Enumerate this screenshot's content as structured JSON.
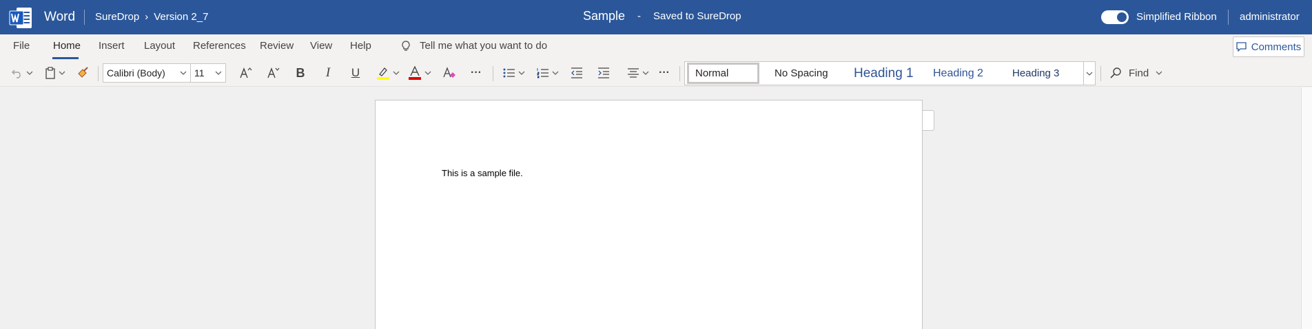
{
  "titlebar": {
    "app_name": "Word",
    "breadcrumb": [
      "SureDrop",
      "Version 2_7"
    ],
    "breadcrumb_sep": "›",
    "doc_name": "Sample",
    "title_sep": "-",
    "save_status": "Saved to SureDrop",
    "simplified_ribbon_label": "Simplified Ribbon",
    "simplified_ribbon_on": true,
    "user": "administrator",
    "colors": {
      "bar": "#2b579a"
    }
  },
  "tabs": {
    "items": [
      "File",
      "Home",
      "Insert",
      "Layout",
      "References",
      "Review",
      "View",
      "Help"
    ],
    "active": "Home",
    "tell_me": "Tell me what you want to do",
    "comments_label": "Comments"
  },
  "ribbon": {
    "font_name": "Calibri (Body)",
    "font_size": "11",
    "bold_label": "B",
    "italic_label": "I",
    "underline_label": "U",
    "more_label": "···",
    "highlight_color": "#ffff00",
    "font_color": "#e00000",
    "styles": [
      "Normal",
      "No Spacing",
      "Heading 1",
      "Heading 2",
      "Heading 3"
    ],
    "selected_style": "Normal",
    "find_label": "Find"
  },
  "document": {
    "body_text": "This is a sample file."
  }
}
